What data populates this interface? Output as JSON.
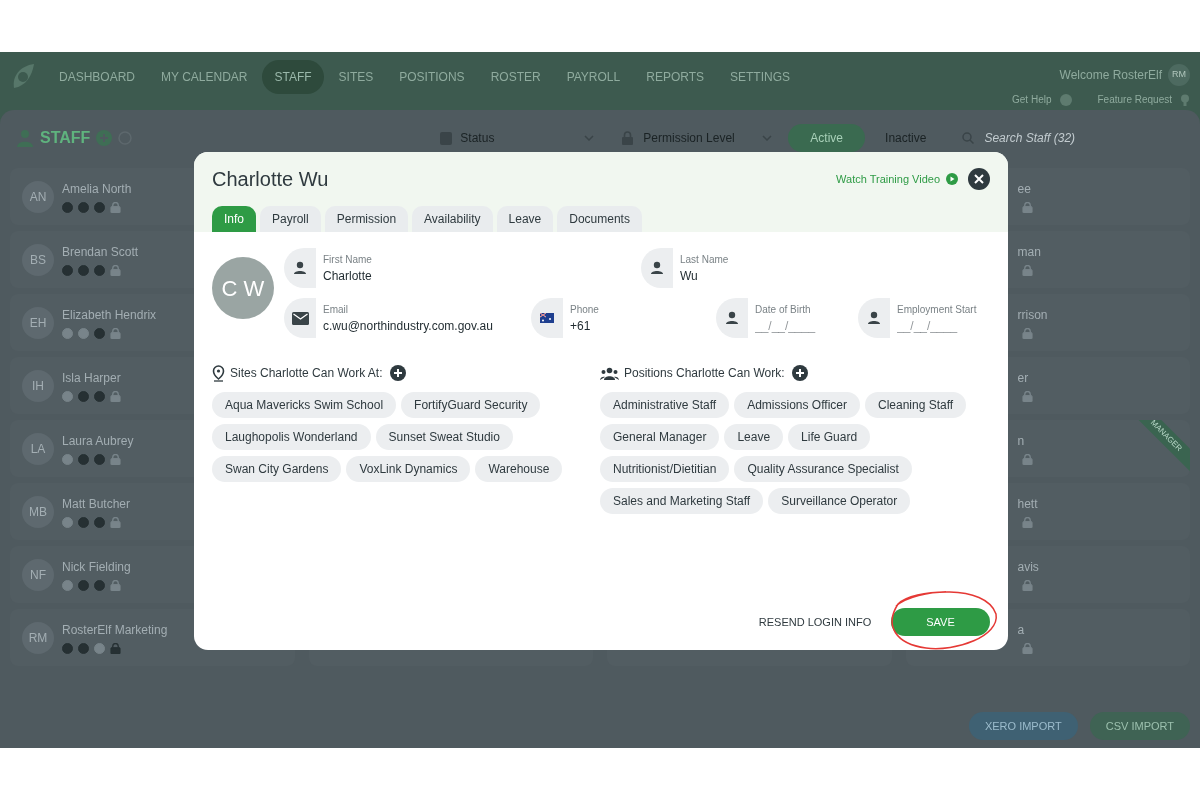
{
  "nav": {
    "items": [
      {
        "label": "DASHBOARD",
        "selected": false
      },
      {
        "label": "MY CALENDAR",
        "selected": false
      },
      {
        "label": "STAFF",
        "selected": true
      },
      {
        "label": "SITES",
        "selected": false
      },
      {
        "label": "POSITIONS",
        "selected": false
      },
      {
        "label": "ROSTER",
        "selected": false
      },
      {
        "label": "PAYROLL",
        "selected": false
      },
      {
        "label": "REPORTS",
        "selected": false
      },
      {
        "label": "SETTINGS",
        "selected": false
      }
    ],
    "welcome": "Welcome RosterElf",
    "user_initials": "RM",
    "get_help": "Get Help",
    "feature_request": "Feature Request"
  },
  "staff_header": {
    "title": "STAFF",
    "status_filter": "Status",
    "permission_filter": "Permission Level",
    "toggle": [
      {
        "label": "Active",
        "selected": true
      },
      {
        "label": "Inactive",
        "selected": false
      }
    ],
    "search_placeholder": "Search Staff (32)"
  },
  "staff_cards": [
    {
      "initials": "AN",
      "name": "Amelia North",
      "icons": [
        {
          "kind": "person",
          "on": true
        },
        {
          "kind": "dollar",
          "on": true
        },
        {
          "kind": "sync",
          "on": true
        },
        {
          "kind": "lock",
          "on": false
        }
      ]
    },
    {
      "initials": "BS",
      "name": "Brendan Scott",
      "icons": [
        {
          "kind": "person",
          "on": true
        },
        {
          "kind": "dollar",
          "on": true
        },
        {
          "kind": "sync",
          "on": true
        },
        {
          "kind": "lock",
          "on": false
        }
      ]
    },
    {
      "initials": "EH",
      "name": "Elizabeth Hendrix",
      "icons": [
        {
          "kind": "person",
          "on": false
        },
        {
          "kind": "dollar",
          "on": false
        },
        {
          "kind": "sync",
          "on": true
        },
        {
          "kind": "lock",
          "on": false
        }
      ]
    },
    {
      "initials": "IH",
      "name": "Isla Harper",
      "icons": [
        {
          "kind": "person",
          "on": false
        },
        {
          "kind": "dollar",
          "on": true
        },
        {
          "kind": "sync",
          "on": true
        },
        {
          "kind": "lock",
          "on": false
        }
      ]
    },
    {
      "initials": "LA",
      "name": "Laura Aubrey",
      "icons": [
        {
          "kind": "person",
          "on": false
        },
        {
          "kind": "dollar",
          "on": true
        },
        {
          "kind": "sync",
          "on": true
        },
        {
          "kind": "lock",
          "on": false
        }
      ]
    },
    {
      "initials": "MB",
      "name": "Matt Butcher",
      "icons": [
        {
          "kind": "person",
          "on": false
        },
        {
          "kind": "dollar",
          "on": true
        },
        {
          "kind": "sync",
          "on": true
        },
        {
          "kind": "lock",
          "on": false
        }
      ]
    },
    {
      "initials": "NF",
      "name": "Nick Fielding",
      "icons": [
        {
          "kind": "person",
          "on": false
        },
        {
          "kind": "dollar",
          "on": true
        },
        {
          "kind": "sync",
          "on": true
        },
        {
          "kind": "lock",
          "on": false
        }
      ]
    },
    {
      "initials": "RM",
      "name": "RosterElf Marketing",
      "icons": [
        {
          "kind": "person",
          "on": true
        },
        {
          "kind": "dollar",
          "on": true
        },
        {
          "kind": "sync",
          "on": false
        },
        {
          "kind": "lock",
          "on": true
        }
      ]
    }
  ],
  "right_cards": [
    {
      "name": "ee"
    },
    {
      "name": "man"
    },
    {
      "name": "rrison"
    },
    {
      "name": "er"
    },
    {
      "name": "n",
      "ribbon": "MANAGER"
    },
    {
      "name": "hett"
    },
    {
      "name": "avis"
    },
    {
      "name": "a"
    }
  ],
  "import_buttons": [
    {
      "label": "XERO IMPORT",
      "kind": "xero"
    },
    {
      "label": "CSV IMPORT",
      "kind": "csv"
    }
  ],
  "modal": {
    "title": "Charlotte Wu",
    "training_link": "Watch Training Video",
    "tabs": [
      {
        "label": "Info",
        "selected": true
      },
      {
        "label": "Payroll",
        "selected": false
      },
      {
        "label": "Permission",
        "selected": false
      },
      {
        "label": "Availability",
        "selected": false
      },
      {
        "label": "Leave",
        "selected": false
      },
      {
        "label": "Documents",
        "selected": false
      }
    ],
    "avatar_initials": "C W",
    "fields": [
      {
        "kind": "person",
        "label": "First Name",
        "value": "Charlotte"
      },
      {
        "kind": "person",
        "label": "Last Name",
        "value": "Wu"
      },
      {
        "kind": "email",
        "label": "Email",
        "value": "c.wu@northindustry.com.gov.au"
      },
      {
        "kind": "phone",
        "label": "Phone",
        "value": "+61"
      },
      {
        "kind": "person",
        "label": "Date of Birth",
        "placeholder": "__/__/____"
      },
      {
        "kind": "person",
        "label": "Employment Start",
        "placeholder": "__/__/____"
      }
    ],
    "sites": {
      "heading": "Sites Charlotte Can Work At:",
      "items": [
        "Aqua Mavericks Swim School",
        "FortifyGuard Security",
        "Laughopolis Wonderland",
        "Sunset Sweat Studio",
        "Swan City Gardens",
        "VoxLink Dynamics",
        "Warehouse"
      ]
    },
    "positions": {
      "heading": "Positions Charlotte Can Work:",
      "items": [
        "Administrative Staff",
        "Admissions Officer",
        "Cleaning Staff",
        "General Manager",
        "Leave",
        "Life Guard",
        "Nutritionist/Dietitian",
        "Quality Assurance Specialist",
        "Sales and Marketing Staff",
        "Surveillance Operator"
      ]
    },
    "buttons": [
      {
        "label": "RESEND LOGIN INFO",
        "kind": "secondary"
      },
      {
        "label": "SAVE",
        "kind": "primary",
        "highlighted": true
      }
    ]
  }
}
